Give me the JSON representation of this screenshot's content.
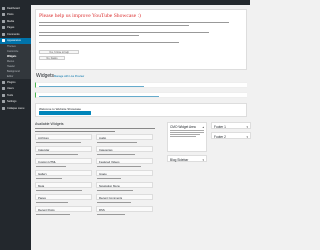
{
  "sidebar": {
    "items": [
      {
        "label": "Dashboard"
      },
      {
        "label": "Posts"
      },
      {
        "label": "Media"
      },
      {
        "label": "Pages"
      },
      {
        "label": "Comments"
      },
      {
        "label": "Appearance",
        "active": true
      },
      {
        "label": "Plugins"
      },
      {
        "label": "Users"
      },
      {
        "label": "Tools"
      },
      {
        "label": "Settings"
      },
      {
        "label": "Collapse menu"
      }
    ],
    "subitems": [
      {
        "label": "Themes"
      },
      {
        "label": "Customize"
      },
      {
        "label": "Widgets",
        "current": true
      },
      {
        "label": "Menus"
      },
      {
        "label": "Header"
      },
      {
        "label": "Background"
      },
      {
        "label": "Editor"
      }
    ]
  },
  "promo": {
    "title": "Please help us improve YouTube Showcase :)",
    "button_primary": "Yes, I'd love to help",
    "button_secondary": "No, thanks"
  },
  "page": {
    "title": "Widgets",
    "manage_link": "Manage with Live Preview"
  },
  "welcome": {
    "title": "Welcome to Website Showcase"
  },
  "available": {
    "title": "Available Widgets",
    "widgets": [
      {
        "label": "Archives"
      },
      {
        "label": "Audio"
      },
      {
        "label": "Calendar"
      },
      {
        "label": "Categories"
      },
      {
        "label": "Custom HTML"
      },
      {
        "label": "Featured Videos"
      },
      {
        "label": "Gallery"
      },
      {
        "label": "Image"
      },
      {
        "label": "Meta"
      },
      {
        "label": "Navigation Menu"
      },
      {
        "label": "Pages"
      },
      {
        "label": "Recent Comments"
      },
      {
        "label": "Recent Posts"
      },
      {
        "label": "RSS"
      }
    ]
  },
  "areas": {
    "cmo": {
      "title": "CMO Widget Area"
    },
    "blog": {
      "title": "Blog Sidebar"
    },
    "footer1": {
      "title": "Footer 1"
    },
    "footer2": {
      "title": "Footer 2"
    }
  }
}
